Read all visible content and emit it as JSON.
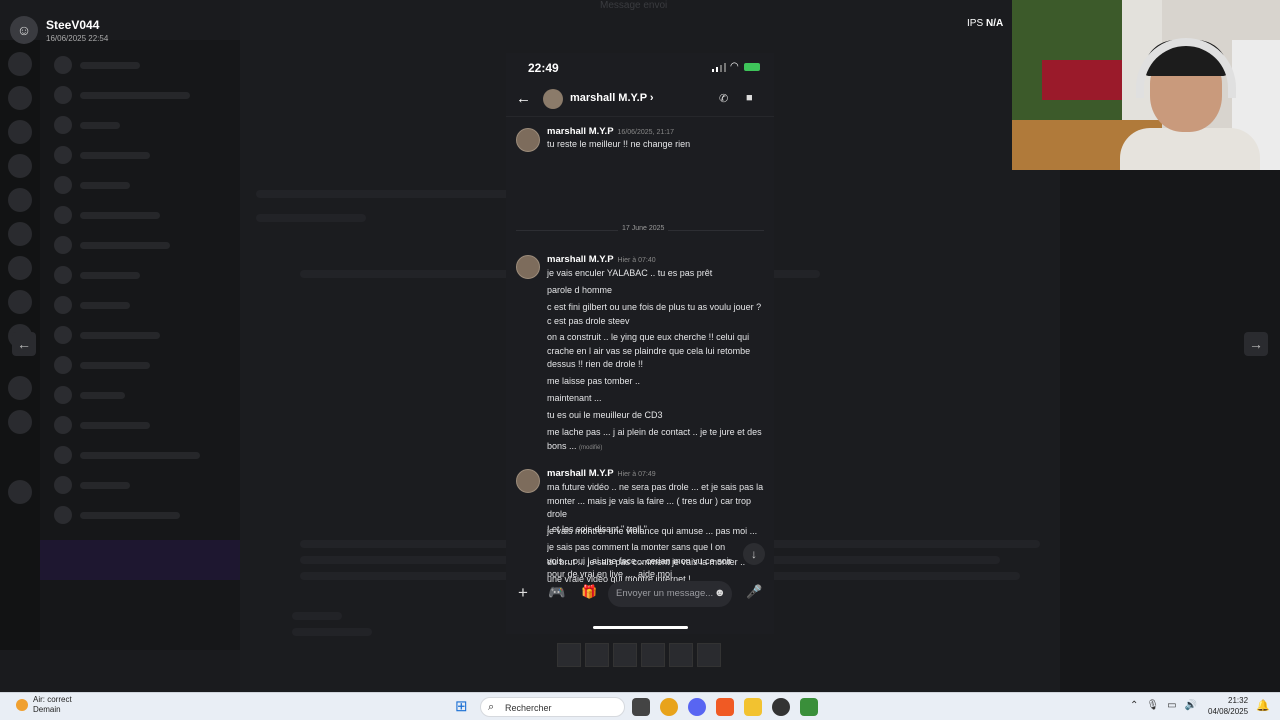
{
  "background_app": {
    "user_name": "SteeV044",
    "user_date": "16/06/2025 22:54",
    "top_hint": "Message envoi",
    "ips": "IPS",
    "na": "N/A"
  },
  "phone": {
    "status_time": "22:49",
    "header_name": "marshall M.Y.P",
    "day_separator": "17 June 2025",
    "composer_placeholder": "Envoyer un message...",
    "messages": [
      {
        "author": "marshall M.Y.P",
        "time": "16/06/2025, 21:17",
        "lines": [
          "tu reste le meilleur !! ne change rien"
        ]
      },
      {
        "author": "marshall M.Y.P",
        "time": "Hier à 07:40",
        "lines": [
          "je vais enculer YALABAC .. tu es pas prêt",
          "parole d homme",
          "c est fini gilbert  ou une fois de plus tu as voulu jouer ?  c est pas drole steev",
          "on a construit ..  le ying  que eux cherche !!  celui qui crache en l air  vas se plaindre que cela lui retombe  dessus !! rien de drole !!",
          "me laisse pas tomber ..",
          "maintenant ...",
          "tu es  oui le meuilleur de CD3",
          "me lache pas ...  j ai plein de contact .. je te jure et des bons ..."
        ],
        "edited": "(modifié)"
      },
      {
        "author": "marshall M.Y.P",
        "time": "Hier à 07:49",
        "lines": [
          "ma future vidéo .. ne sera pas drole ... et je sais pas la monter ... mais je vais la faire ...  ( tres dur  ) car trop drole",
          "je vais montrer une violance qui amuse  ... pas moi ...",
          "du brut ... je sais pas comment je vais la monter ..",
          "une vraie vidéo qui montre internet  !",
          "! et les sois disant  \" troll \"",
          "je sais pas comment la monter sans que l on vois .. oui j ai une face .. cerian mon vu ce soir pour de vrai en live .... aide moi"
        ]
      }
    ]
  },
  "taskbar": {
    "weather_title": "Air: correct",
    "weather_sub": "Demain",
    "search_label": "Rechercher",
    "time": "21:32",
    "date": "04/08/2025"
  },
  "colors": {
    "phone_bg": "#1c1d21",
    "taskbar_bg": "#e9eef5",
    "accent_blue": "#1a6fd4"
  }
}
